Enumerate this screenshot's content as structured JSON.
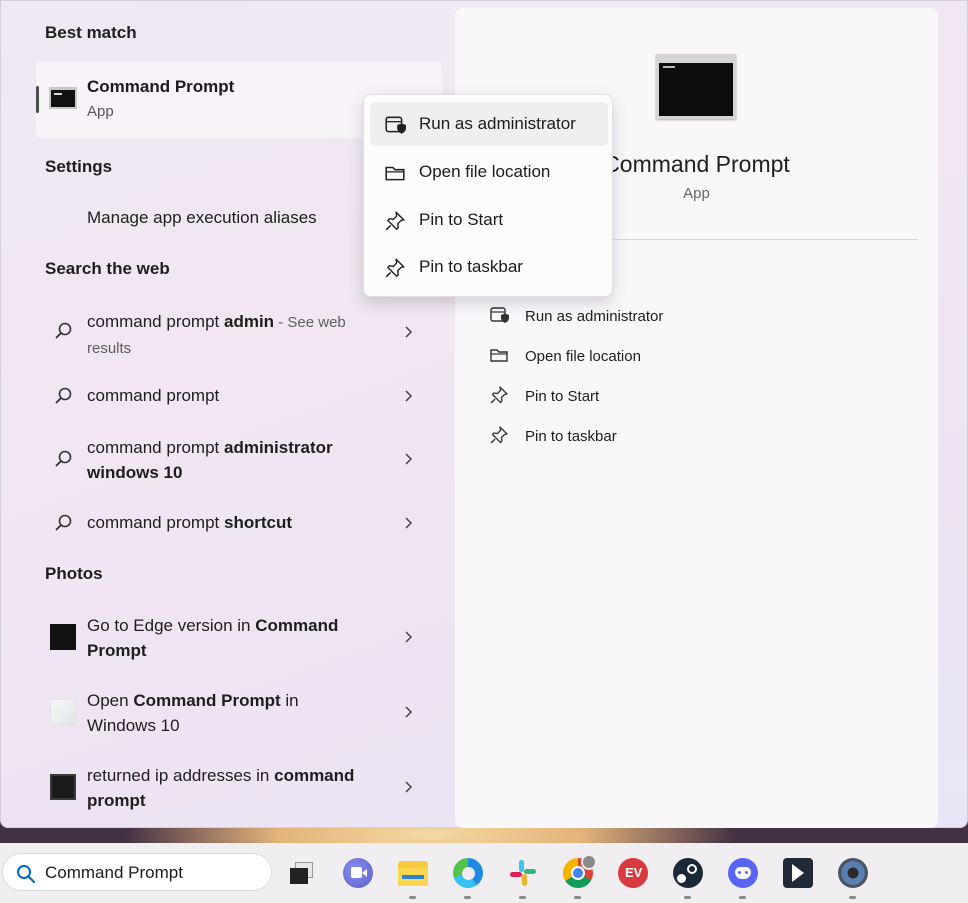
{
  "best_match": {
    "section_title": "Best match",
    "app_name": "Command Prompt",
    "app_type": "App"
  },
  "settings": {
    "section_title": "Settings",
    "item": "Manage app execution aliases"
  },
  "search_web": {
    "section_title": "Search the web",
    "items": [
      {
        "prefix": "command prompt ",
        "bold": "admin",
        "suffix": " - See web",
        "line2": "results"
      },
      {
        "prefix": "command prompt",
        "bold": "",
        "suffix": "",
        "line2": ""
      },
      {
        "prefix": "command prompt ",
        "bold": "administrator",
        "suffix": "",
        "line2": "windows 10"
      },
      {
        "prefix": "command prompt ",
        "bold": "shortcut",
        "suffix": "",
        "line2": ""
      }
    ]
  },
  "photos": {
    "section_title": "Photos",
    "items": [
      {
        "line1_a": "Go to Edge version in ",
        "line1_b": "Command",
        "line2_a": "",
        "line2_b": "Prompt",
        "line2_c": ""
      },
      {
        "line1_a": "Open ",
        "line1_b": "Command Prompt",
        "line1_c": " in",
        "line2_a": "Windows 10"
      },
      {
        "line1_a": "returned ip addresses in ",
        "line1_b": "command",
        "line2_b": "prompt"
      }
    ]
  },
  "details": {
    "title": "Command Prompt",
    "subtitle": "App",
    "actions": [
      "Run as administrator",
      "Open file location",
      "Pin to Start",
      "Pin to taskbar"
    ]
  },
  "context_menu": {
    "items": [
      "Run as administrator",
      "Open file location",
      "Pin to Start",
      "Pin to taskbar"
    ],
    "highlighted_index": 0
  },
  "taskbar": {
    "search_value": "Command Prompt",
    "icons": [
      "task-view-icon",
      "teams-icon",
      "file-explorer-icon",
      "edge-icon",
      "slack-icon",
      "chrome-icon",
      "expressvpn-icon",
      "steam-icon",
      "discord-icon",
      "app-icon",
      "settings-icon"
    ]
  },
  "colors": {
    "accent": "#0067c0",
    "panel_bg": "#efe9f3"
  }
}
